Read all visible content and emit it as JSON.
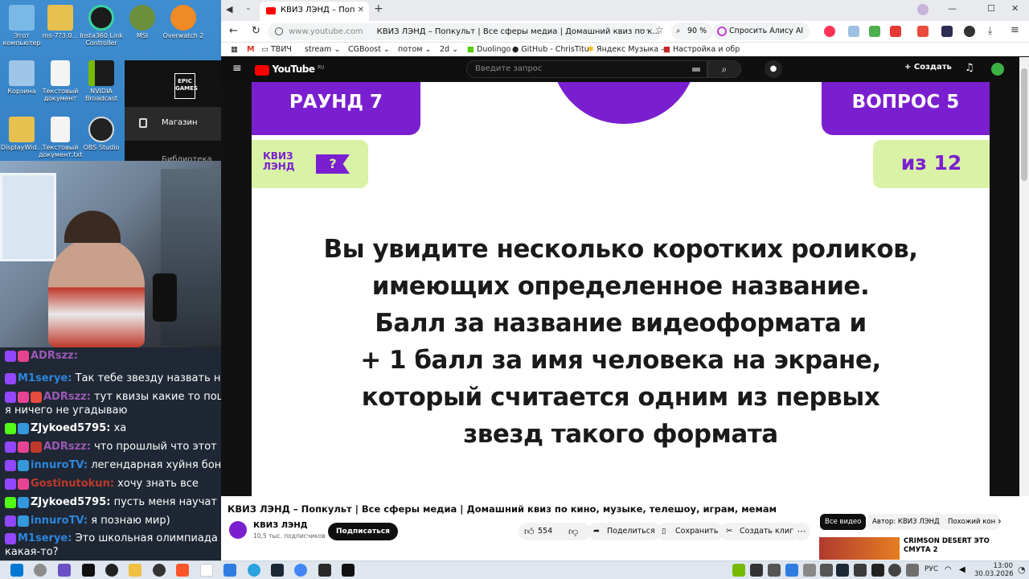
{
  "desktop": {
    "icons": [
      {
        "label": "Этот компьютер",
        "color": "#7ab8e8"
      },
      {
        "label": "ms-7?3.0...",
        "color": "#e7c04f"
      },
      {
        "label": "Insta360 Link Controller",
        "color": "#1b1b1b"
      },
      {
        "label": "MSI",
        "color": "#6b8f3a"
      },
      {
        "label": "Overwatch 2",
        "color": "#f08a24"
      },
      {
        "label": "Корзина",
        "color": "#9fc5e8"
      },
      {
        "label": "Текстовый документ",
        "color": "#f4f4f4"
      },
      {
        "label": "NVIDIA Broadcast",
        "color": "#1b1b1b"
      },
      {
        "label": "DisplayWid...",
        "color": "#e7c04f"
      },
      {
        "label": "Текстовый документ.txt",
        "color": "#f4f4f4"
      },
      {
        "label": "OBS Studio",
        "color": "#222222"
      }
    ],
    "epic": {
      "logo": "EPIC GAMES",
      "menu_item": "Магазин",
      "menu_item2": "Библиотека"
    }
  },
  "chat": {
    "messages": [
      {
        "user": "ADRszz:",
        "text": "",
        "color": "#9b59b6"
      },
      {
        "user": "M1serye:",
        "text": "Так тебе звезду назвать надо",
        "color": "#2e86de"
      },
      {
        "user": "ADRszz:",
        "text": "тут квизы какие то пошли, я ничего не угадываю",
        "color": "#9b59b6"
      },
      {
        "user": "ZJykoed5795:",
        "text": "ха",
        "color": "#ffffff"
      },
      {
        "user": "ADRszz:",
        "text": "что прошлый что этот",
        "color": "#9b59b6"
      },
      {
        "user": "innuroTV:",
        "text": "легендарная хуйня бонус",
        "color": "#2e86de"
      },
      {
        "user": "Gostinutokun:",
        "text": "хочу знать все",
        "color": "#c0392b"
      },
      {
        "user": "ZJykoed5795:",
        "text": "пусть меня научат",
        "color": "#ffffff"
      },
      {
        "user": "innuroTV:",
        "text": "я познаю мир)",
        "color": "#2e86de"
      },
      {
        "user": "M1serye:",
        "text": "Это школьная олимпиада какая-то?",
        "color": "#2e86de"
      }
    ]
  },
  "browser": {
    "tab_title": "КВИЗ ЛЭНД – Попкі",
    "url_host": "www.youtube.com",
    "url_title": "КВИЗ ЛЭНД – Попкульт | Все сферы медиа | Домашний квиз по к...",
    "zoom": "90 %",
    "alice": "Спросить Алису AI",
    "bookmarks": [
      "ТВИЧ",
      "stream",
      "CGBoost",
      "потом",
      "2d",
      "Duolingo",
      "GitHub - ChrisTitu",
      "Яндекс Музыка –",
      "Настройка и обр"
    ]
  },
  "youtube": {
    "logo": "YouTube",
    "logo_sup": "RU",
    "search_placeholder": "Введите запрос",
    "create": "Создать",
    "slide": {
      "round": "РАУНД 7",
      "question": "ВОПРОС 5",
      "of": "из 12",
      "brand": "КВИЗ ЛЭНД",
      "lines": [
        "Вы увидите несколько коротких роликов,",
        "имеющих определенное название.",
        "Балл за название видеоформата и",
        "+ 1 балл за имя человека на экране,",
        "который считается одним из первых",
        "звезд такого формата"
      ]
    },
    "video_title": "КВИЗ ЛЭНД – Попкульт | Все сферы медиа | Домашний квиз по кино, музыке, телешоу, играм, мемам",
    "channel": "КВИЗ ЛЭНД",
    "subs": "10,5 тыс. подписчиков",
    "subscribe": "Подписаться",
    "likes": "554",
    "share": "Поделиться",
    "save": "Сохранить",
    "clip": "Создать клип",
    "chips": [
      "Все видео",
      "Автор: КВИЗ ЛЭНД",
      "Похожий кон"
    ],
    "rec_title": "CRIMSON DESERT ЭТО СМУТА 2"
  },
  "taskbar": {
    "lang": "РУС",
    "time": "13:00",
    "date": "30.03.2026"
  },
  "colors": {
    "purple": "#7a1fd0",
    "lime": "#d9f2a6",
    "yt_red": "#ff0000"
  }
}
